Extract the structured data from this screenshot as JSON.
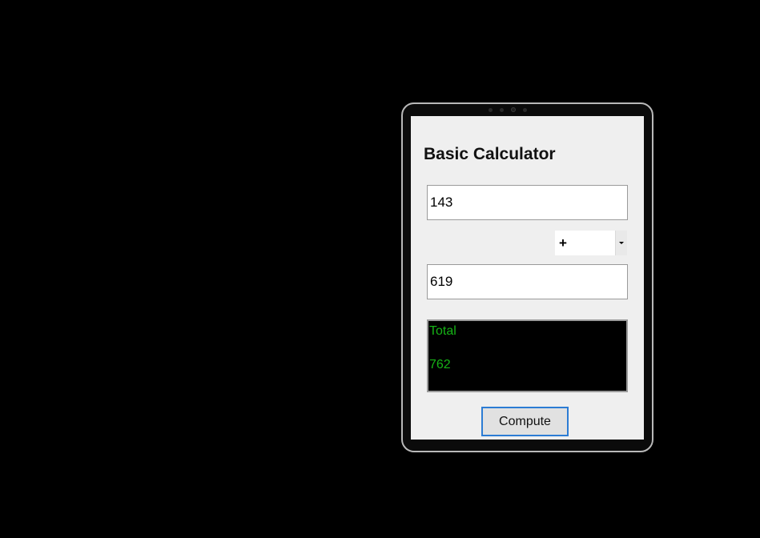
{
  "calculator": {
    "title": "Basic Calculator",
    "first_value": "143",
    "operator": "+",
    "second_value": "619",
    "output": {
      "label": "Total",
      "result": "762"
    },
    "compute_label": "Compute"
  },
  "colors": {
    "background": "#000000",
    "screen_bg": "#efefef",
    "output_bg": "#000000",
    "output_text": "#16b316",
    "button_focus_border": "#2c7cd4"
  },
  "icons": {
    "dropdown": "chevron-down-icon",
    "camera": "camera-icon"
  }
}
